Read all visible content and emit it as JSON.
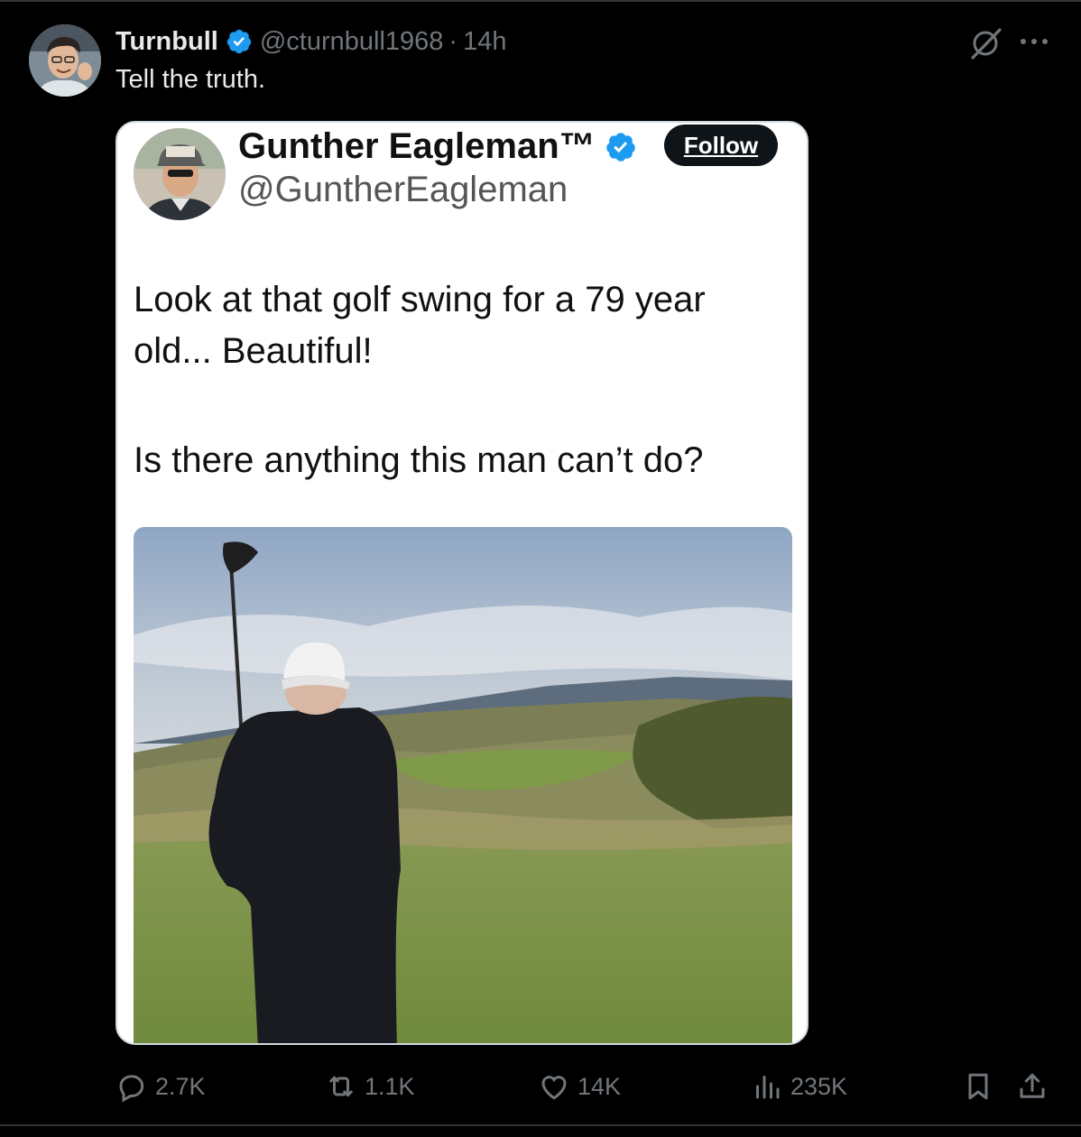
{
  "post": {
    "author_name": "Turnbull",
    "author_handle": "@cturnbull1968",
    "separator": "·",
    "time": "14h",
    "text": "Tell the truth."
  },
  "embedded": {
    "name": "Gunther Eagleman™",
    "handle": "@GuntherEagleman",
    "follow_label": "Follow",
    "text_line1": "Look at that golf swing for a 79 year old... Beautiful!",
    "text_line2": "Is there anything this man can’t do?"
  },
  "actions": {
    "replies": "2.7K",
    "reposts": "1.1K",
    "likes": "14K",
    "views": "235K"
  },
  "icons": [
    "verified-badge-icon",
    "grok-icon",
    "more-icon",
    "reply-icon",
    "repost-icon",
    "like-icon",
    "views-icon",
    "bookmark-icon",
    "share-icon"
  ],
  "colors": {
    "verified": "#1d9bf0",
    "muted": "#71767b",
    "text": "#e7e9ea",
    "background": "#000000"
  }
}
